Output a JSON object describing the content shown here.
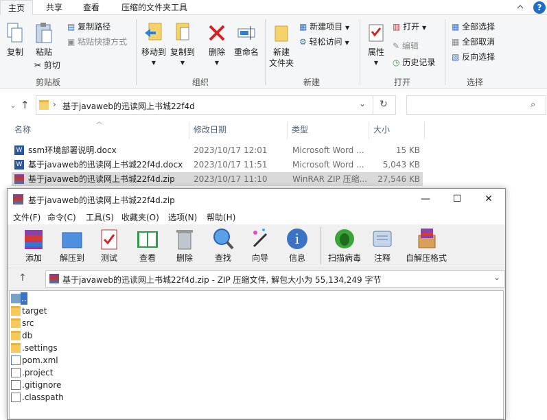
{
  "tabs": [
    "主页",
    "共享",
    "查看",
    "压缩的文件夹工具"
  ],
  "ribbon": {
    "copy": "复制",
    "paste": "粘贴",
    "copy_path": "复制路径",
    "paste_shortcut": "粘贴快捷方式",
    "cut": "剪切",
    "group_clipboard": "剪贴板",
    "move_to": "移动到",
    "copy_to": "复制到",
    "delete": "删除",
    "rename": "重命名",
    "group_organize": "组织",
    "new_item": "新建项目",
    "easy_access": "轻松访问",
    "new_folder": "新建\n文件夹",
    "group_new": "新建",
    "properties": "属性",
    "open": "打开",
    "edit": "编辑",
    "history": "历史记录",
    "group_open": "打开",
    "select_all": "全部选择",
    "select_none": "全部取消",
    "invert_select": "反向选择",
    "group_select": "选择"
  },
  "address": {
    "path": "基于javaweb的迅读网上书城22f4d"
  },
  "columns": {
    "name": "名称",
    "date": "修改日期",
    "type": "类型",
    "size": "大小"
  },
  "files": [
    {
      "name": "ssm环境部署说明.docx",
      "date": "2023/10/17 12:01",
      "type": "Microsoft Word ...",
      "size": "15 KB"
    },
    {
      "name": "基于javaweb的迅读网上书城22f4d.docx",
      "date": "2023/10/17 11:51",
      "type": "Microsoft Word ...",
      "size": "5,043 KB"
    },
    {
      "name": "基于javaweb的迅读网上书城22f4d.zip",
      "date": "2023/10/17 11:10",
      "type": "WinRAR ZIP 压缩...",
      "size": "27,546 KB"
    }
  ],
  "winrar": {
    "title": "基于javaweb的迅读网上书城22f4d.zip",
    "menu": [
      "文件(F)",
      "命令(C)",
      "工具(S)",
      "收藏夹(O)",
      "选项(N)",
      "帮助(H)"
    ],
    "toolbar": [
      "添加",
      "解压到",
      "测试",
      "查看",
      "删除",
      "查找",
      "向导",
      "信息",
      "扫描病毒",
      "注释",
      "自解压格式"
    ],
    "archive_info": "基于javaweb的迅读网上书城22f4d.zip - ZIP 压缩文件, 解包大小为 55,134,249 字节",
    "items": [
      {
        "name": "..",
        "kind": "up"
      },
      {
        "name": "target",
        "kind": "folder"
      },
      {
        "name": "src",
        "kind": "folder"
      },
      {
        "name": "db",
        "kind": "folder"
      },
      {
        "name": ".settings",
        "kind": "folder"
      },
      {
        "name": "pom.xml",
        "kind": "xml"
      },
      {
        "name": ".project",
        "kind": "file"
      },
      {
        "name": ".gitignore",
        "kind": "file"
      },
      {
        "name": ".classpath",
        "kind": "file"
      }
    ]
  }
}
